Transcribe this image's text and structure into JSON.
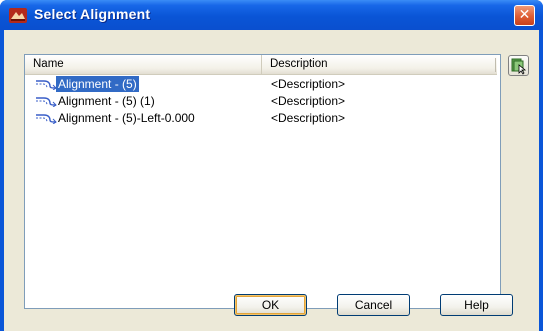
{
  "window": {
    "title": "Select Alignment",
    "close_glyph": "✕"
  },
  "list": {
    "columns": [
      "Name",
      "Description"
    ],
    "rows": [
      {
        "name": "Alignment - (5)",
        "description": "<Description>",
        "selected": true
      },
      {
        "name": "Alignment - (5) (1)",
        "description": "<Description>",
        "selected": false
      },
      {
        "name": "Alignment - (5)-Left-0.000",
        "description": "<Description>",
        "selected": false
      }
    ]
  },
  "buttons": {
    "ok": "OK",
    "cancel": "Cancel",
    "help": "Help"
  },
  "icons": {
    "app": "civil3d-app-icon",
    "row": "alignment-icon",
    "pick": "pick-from-drawing-icon"
  },
  "colors": {
    "titlebar": "#0a55d6",
    "selection": "#316ac5",
    "dialog_bg": "#ece9d8",
    "close_button": "#de5d34"
  }
}
